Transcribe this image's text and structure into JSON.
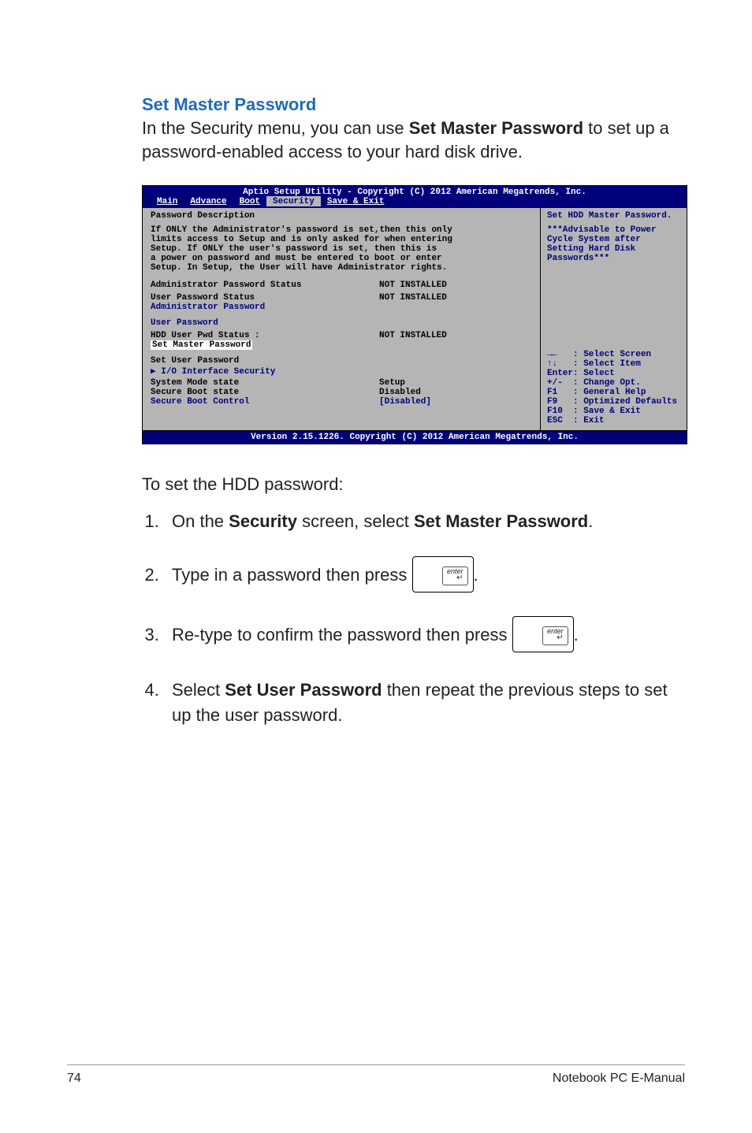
{
  "heading": "Set Master Password",
  "intro_pre": "In the Security menu, you can use ",
  "intro_bold": "Set Master Password",
  "intro_post": " to set up a password-enabled access to your hard disk drive.",
  "bios": {
    "title": "Aptio Setup Utility - Copyright (C) 2012 American Megatrends, Inc.",
    "tabs": {
      "main": "Main",
      "advance": "Advance",
      "boot": "Boot",
      "security": "Security",
      "save": "Save & Exit"
    },
    "left": {
      "pd_title": "Password Description",
      "pd_l1": "If ONLY the Administrator's password is set,then this only",
      "pd_l2": "limits access to Setup and is only asked for when entering",
      "pd_l3": "Setup. If ONLY the user's password is set, then this is",
      "pd_l4": "a power on password and must be entered to boot or enter",
      "pd_l5": "Setup. In Setup, the User will have Administrator rights.",
      "aps_label": "Administrator Password Status",
      "aps_val": "NOT INSTALLED",
      "ups_label": "User Password Status",
      "ups_val": "NOT INSTALLED",
      "admin_pw": "Administrator Password",
      "user_pw": "User Password",
      "hdd_label": "HDD User Pwd Status :",
      "hdd_val": "NOT INSTALLED",
      "set_master": "Set Master Password",
      "set_user": "Set User Password",
      "io": "I/O Interface Security",
      "sysmode_l": "System Mode state",
      "sysmode_v": "Setup",
      "sbstate_l": "Secure Boot state",
      "sbstate_v": "Disabled",
      "sbctrl_l": "Secure Boot Control",
      "sbctrl_v": "[Disabled]"
    },
    "right": {
      "r1": "Set HDD Master Password.",
      "r2": "***Advisable to Power",
      "r3": "Cycle System after",
      "r4": "Setting Hard Disk",
      "r5": "Passwords***",
      "h1": "→←   : Select Screen",
      "h2": "↑↓   : Select Item",
      "h3": "Enter: Select",
      "h4": "+/-  : Change Opt.",
      "h5": "F1   : General Help",
      "h6": "F9   : Optimized Defaults",
      "h7": "F10  : Save & Exit",
      "h8": "ESC  : Exit"
    },
    "footer": "Version 2.15.1226. Copyright (C) 2012 American Megatrends, Inc."
  },
  "subhead": "To set the HDD password:",
  "steps": {
    "s1_a": "On the ",
    "s1_b": "Security",
    "s1_c": " screen, select ",
    "s1_d": "Set Master Password",
    "s1_e": ".",
    "s2_a": "Type in a password then press ",
    "s3_a": "Re-type to confirm the password then press ",
    "s4_a": "Select ",
    "s4_b": "Set User Password",
    "s4_c": " then repeat the previous steps to set up the user password."
  },
  "key_label": "enter",
  "key_arrow": "↵",
  "footer": {
    "page": "74",
    "title": "Notebook PC E-Manual"
  }
}
